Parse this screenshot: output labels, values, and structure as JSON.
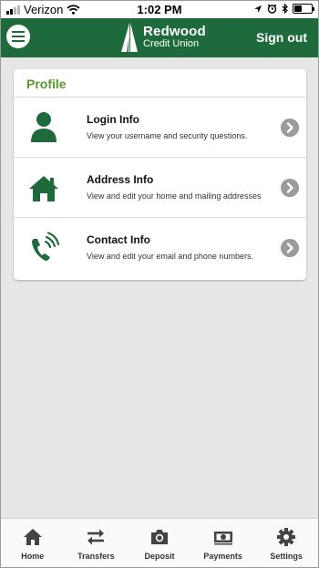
{
  "status_bar": {
    "carrier": "Verizon",
    "time": "1:02 PM",
    "signal_bars_filled": 2,
    "signal_bars_total": 4,
    "battery_level": 0.4
  },
  "header": {
    "logo_line1": "Redwood",
    "logo_line2": "Credit Union",
    "sign_out_label": "Sign out",
    "brand_color": "#1e6a3d"
  },
  "profile": {
    "title": "Profile",
    "accent_color": "#5a9a2a",
    "items": [
      {
        "label": "Login Info",
        "description": "View your username and security questions.",
        "icon": "user-icon"
      },
      {
        "label": "Address Info",
        "description": "View and edit your home and mailing addresses",
        "icon": "home-icon"
      },
      {
        "label": "Contact Info",
        "description": "View and edit your email and phone numbers.",
        "icon": "phone-icon"
      }
    ]
  },
  "tabs": [
    {
      "label": "Home",
      "icon": "home-tab-icon"
    },
    {
      "label": "Transfers",
      "icon": "transfer-arrows-icon"
    },
    {
      "label": "Deposit",
      "icon": "camera-icon"
    },
    {
      "label": "Payments",
      "icon": "cash-icon"
    },
    {
      "label": "Settings",
      "icon": "gear-icon"
    }
  ]
}
